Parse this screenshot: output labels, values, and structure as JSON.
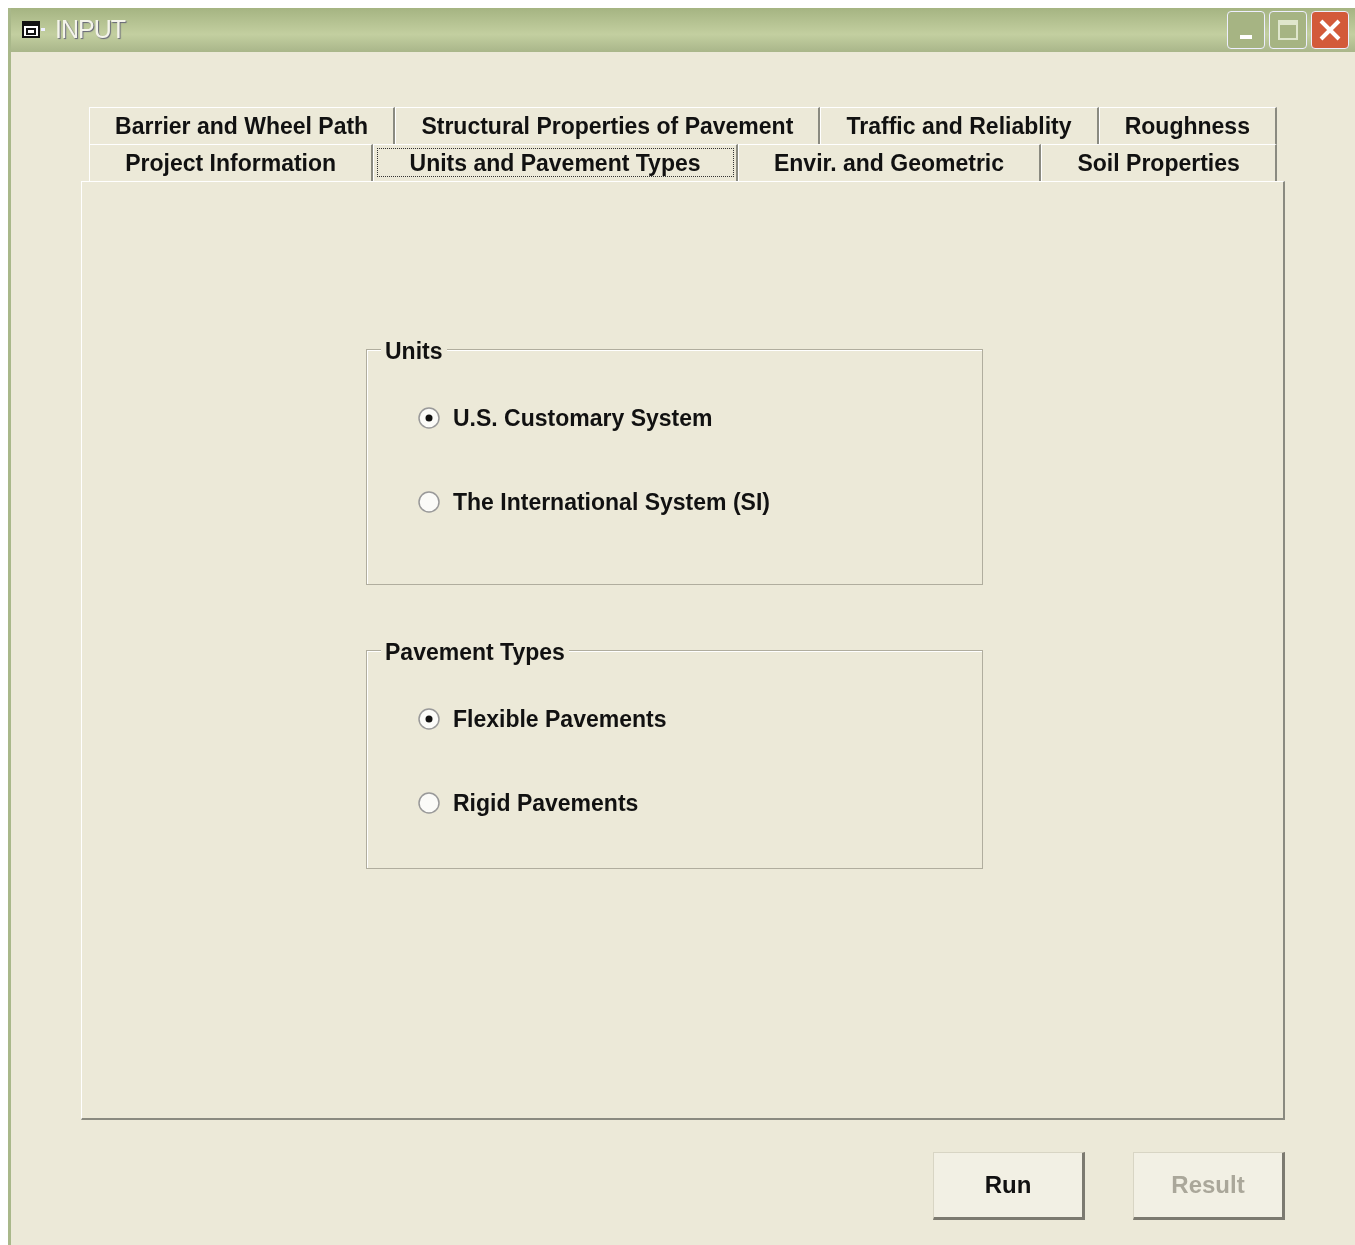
{
  "window": {
    "title": "INPUT"
  },
  "tab_rows": [
    {
      "tabs": [
        {
          "label": "Barrier and Wheel Path",
          "selected": false
        },
        {
          "label": "Structural Properties of Pavement",
          "selected": false
        },
        {
          "label": "Traffic and Reliablity",
          "selected": false
        },
        {
          "label": "Roughness",
          "selected": false
        }
      ]
    },
    {
      "tabs": [
        {
          "label": "Project Information",
          "selected": false
        },
        {
          "label": "Units and Pavement Types",
          "selected": true
        },
        {
          "label": "Envir. and Geometric",
          "selected": false
        },
        {
          "label": "Soil Properties",
          "selected": false
        }
      ]
    }
  ],
  "groups": [
    {
      "title": "Units",
      "options": [
        {
          "label": "U.S. Customary System",
          "selected": true
        },
        {
          "label": "The International System (SI)",
          "selected": false
        }
      ]
    },
    {
      "title": "Pavement Types",
      "options": [
        {
          "label": "Flexible Pavements",
          "selected": true
        },
        {
          "label": "Rigid Pavements",
          "selected": false
        }
      ]
    }
  ],
  "buttons": [
    {
      "label": "Run",
      "disabled": false
    },
    {
      "label": "Result",
      "disabled": true
    }
  ]
}
